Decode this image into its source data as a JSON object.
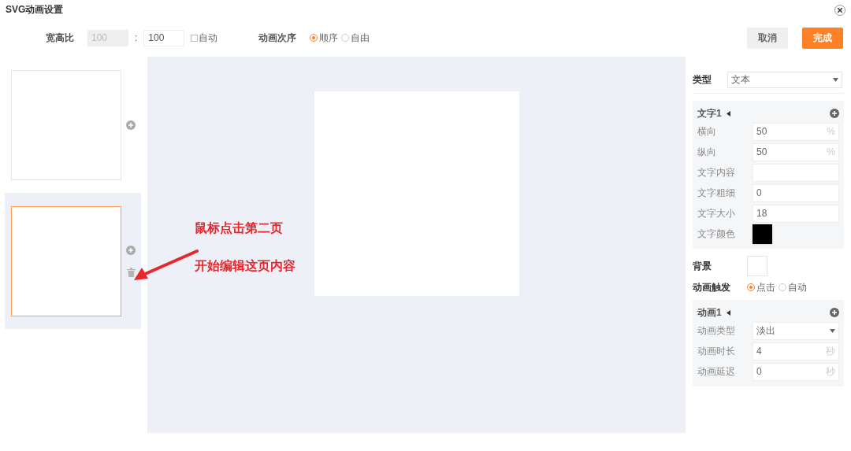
{
  "window": {
    "title": "SVG动画设置"
  },
  "toolbar": {
    "ratio_label": "宽高比",
    "ratio_width": {
      "value": "100",
      "disabled": true
    },
    "ratio_separator": ":",
    "ratio_height": {
      "value": "100",
      "disabled": false
    },
    "auto": {
      "label": "自动",
      "checked": false
    },
    "order_label": "动画次序",
    "order_options": [
      {
        "label": "顺序",
        "selected": true
      },
      {
        "label": "自由",
        "selected": false
      }
    ],
    "buttons": [
      {
        "label": "取消",
        "kind": "secondary"
      },
      {
        "label": "完成",
        "kind": "primary"
      }
    ]
  },
  "pages": [
    {
      "selected": false,
      "deletable": false
    },
    {
      "selected": true,
      "deletable": true
    }
  ],
  "annotations": [
    "鼠标点击第二页",
    "开始编辑这页内容"
  ],
  "properties": {
    "type_label": "类型",
    "type_value": "文本",
    "text_group": {
      "title": "文字1",
      "fields": [
        {
          "kind": "unit",
          "label": "横向",
          "value": "50",
          "unit": "%"
        },
        {
          "kind": "unit",
          "label": "纵向",
          "value": "50",
          "unit": "%"
        },
        {
          "kind": "input",
          "label": "文字内容"
        },
        {
          "kind": "input",
          "label": "文字粗细",
          "value": "0"
        },
        {
          "kind": "input",
          "label": "文字大小",
          "value": "18"
        },
        {
          "kind": "color",
          "label": "文字颜色",
          "color": "#000000"
        }
      ]
    },
    "background": {
      "label": "背景",
      "color": "#ffffff"
    },
    "trigger": {
      "label": "动画触发",
      "options": [
        {
          "label": "点击",
          "selected": true
        },
        {
          "label": "自动",
          "selected": false
        }
      ]
    },
    "animation_group": {
      "title": "动画1",
      "fields": [
        {
          "kind": "select",
          "label": "动画类型",
          "value": "淡出"
        },
        {
          "kind": "unit",
          "label": "动画时长",
          "value": "4",
          "unit": "秒"
        },
        {
          "kind": "unit",
          "label": "动画延迟",
          "value": "0",
          "unit": "秒"
        }
      ]
    }
  }
}
